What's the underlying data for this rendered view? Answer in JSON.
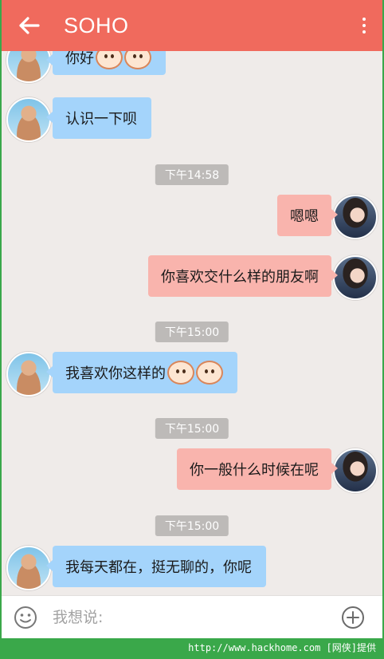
{
  "header": {
    "title": "SOHO"
  },
  "messages": [
    {
      "side": "in",
      "text": "你好",
      "emojis": 2
    },
    {
      "side": "in",
      "text": "认识一下呗",
      "emojis": 0
    },
    {
      "side": "out",
      "text": "嗯嗯",
      "emojis": 0
    },
    {
      "side": "out",
      "text": "你喜欢交什么样的朋友啊",
      "emojis": 0
    },
    {
      "side": "in",
      "text": "我喜欢你这样的",
      "emojis": 2
    },
    {
      "side": "out",
      "text": "你一般什么时候在呢",
      "emojis": 0
    },
    {
      "side": "in",
      "text": "我每天都在，挺无聊的，你呢",
      "emojis": 0
    }
  ],
  "timestamps": [
    "下午14:58",
    "下午15:00",
    "下午15:00",
    "下午15:00"
  ],
  "composer": {
    "placeholder": "我想说:"
  },
  "watermark": "http://www.hackhome.com [网侠]提供"
}
